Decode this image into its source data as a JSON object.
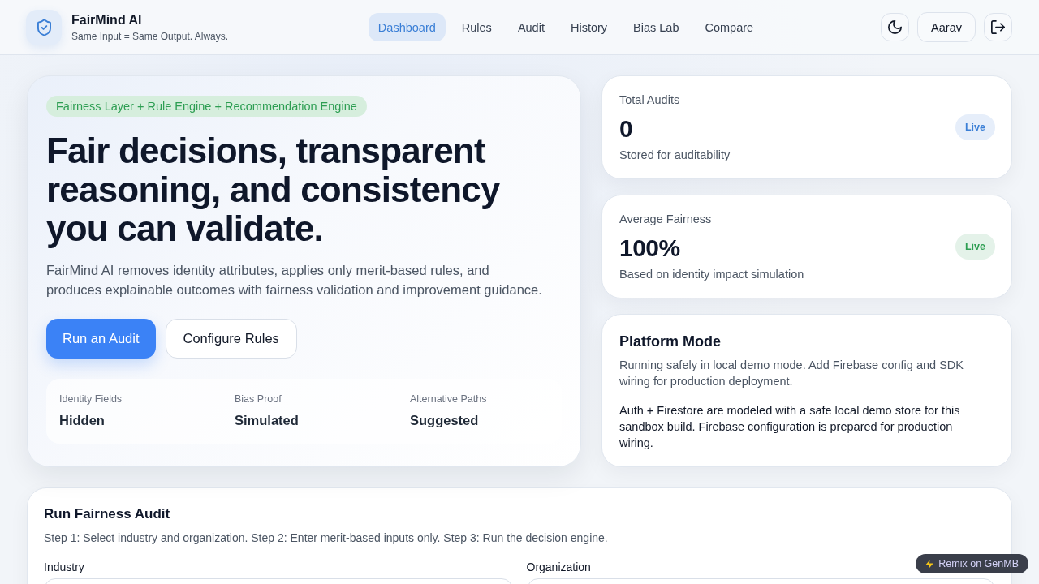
{
  "header": {
    "brand": {
      "name": "FairMind AI",
      "tagline": "Same Input = Same Output. Always."
    },
    "nav": [
      {
        "label": "Dashboard",
        "selected": true
      },
      {
        "label": "Rules",
        "selected": false
      },
      {
        "label": "Audit",
        "selected": false
      },
      {
        "label": "History",
        "selected": false
      },
      {
        "label": "Bias Lab",
        "selected": false
      },
      {
        "label": "Compare",
        "selected": false
      }
    ],
    "user": {
      "name": "Aarav"
    }
  },
  "hero": {
    "tag": "Fairness Layer + Rule Engine + Recommendation Engine",
    "heading": "Fair decisions, transparent reasoning, and consistency you can validate.",
    "description": "FairMind AI removes identity attributes, applies only merit-based rules, and produces explainable outcomes with fairness validation and improvement guidance.",
    "buttons": [
      {
        "label": "Run an Audit",
        "kind": "primary"
      },
      {
        "label": "Configure Rules",
        "kind": "secondary"
      }
    ],
    "highlights": [
      {
        "label": "Identity Fields",
        "value": "Hidden"
      },
      {
        "label": "Bias Proof",
        "value": "Simulated"
      },
      {
        "label": "Alternative Paths",
        "value": "Suggested"
      }
    ]
  },
  "stats": [
    {
      "label": "Total Audits",
      "value": "0",
      "note": "Stored for auditability",
      "badge": "Live",
      "color": "#3b7fd6"
    },
    {
      "label": "Average Fairness",
      "value": "100%",
      "note": "Based on identity impact simulation",
      "badge": "Live",
      "color": "#2e9e53"
    }
  ],
  "platform": {
    "title": "Platform Mode",
    "description": "Running safely in local demo mode. Add Firebase config and SDK wiring for production deployment.",
    "details": "Auth + Firestore are modeled with a safe local demo store for this sandbox build. Firebase configuration is prepared for production wiring."
  },
  "audit_form": {
    "title": "Run Fairness Audit",
    "steps": "Step 1: Select industry and organization. Step 2: Enter merit-based inputs only. Step 3: Run the decision engine.",
    "fields": [
      {
        "label": "Industry"
      },
      {
        "label": "Organization"
      }
    ]
  },
  "remix_button": {
    "label": "Remix on GenMB"
  }
}
